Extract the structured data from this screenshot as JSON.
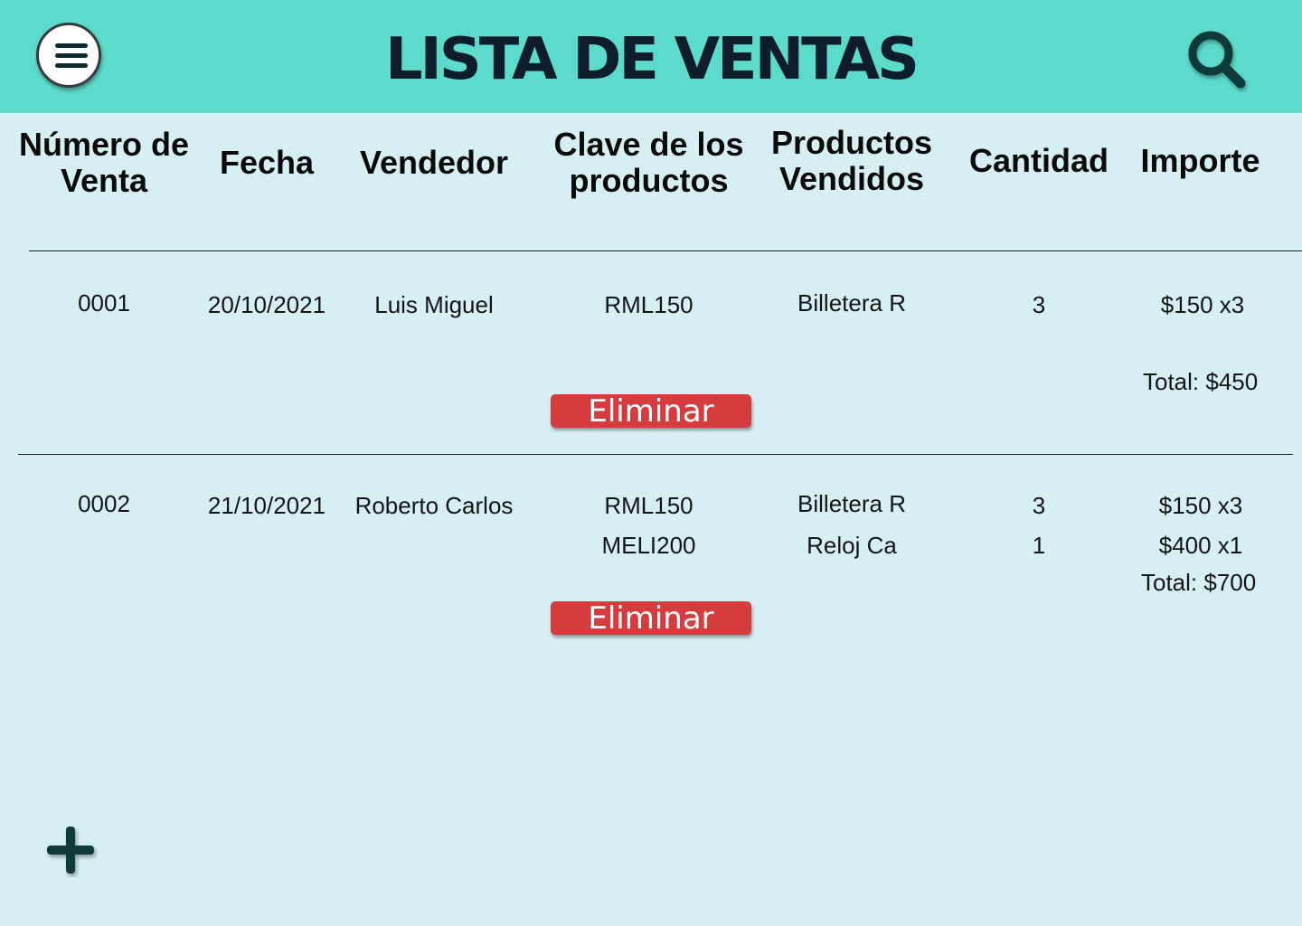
{
  "header": {
    "title": "LISTA DE VENTAS",
    "menu_icon": "hamburger-menu-icon",
    "search_icon": "search-icon",
    "background_color": "#5cdbcd"
  },
  "table": {
    "columns": [
      "Número de Venta",
      "Fecha",
      "Vendedor",
      "Clave de los productos",
      "Productos Vendidos",
      "Cantidad",
      "Importe"
    ],
    "rows": [
      {
        "numero": "0001",
        "fecha": "20/10/2021",
        "vendedor": "Luis Miguel",
        "items": [
          {
            "clave": "RML150",
            "producto": "Billetera R",
            "cantidad": "3",
            "importe": "$150 x3"
          }
        ],
        "total": "Total: $450",
        "delete_label": "Eliminar"
      },
      {
        "numero": "0002",
        "fecha": "21/10/2021",
        "vendedor": "Roberto Carlos",
        "items": [
          {
            "clave": "RML150",
            "producto": "Billetera R",
            "cantidad": "3",
            "importe": "$150 x3"
          },
          {
            "clave": "MELI200",
            "producto": "Reloj Ca",
            "cantidad": "1",
            "importe": "$400 x1"
          }
        ],
        "total": "Total: $700",
        "delete_label": "Eliminar"
      }
    ]
  },
  "add_button": {
    "icon": "plus-icon"
  },
  "colors": {
    "page_background": "#d6eff3",
    "delete_button": "#d63b3e",
    "icon_dark": "#0f3a3a"
  }
}
